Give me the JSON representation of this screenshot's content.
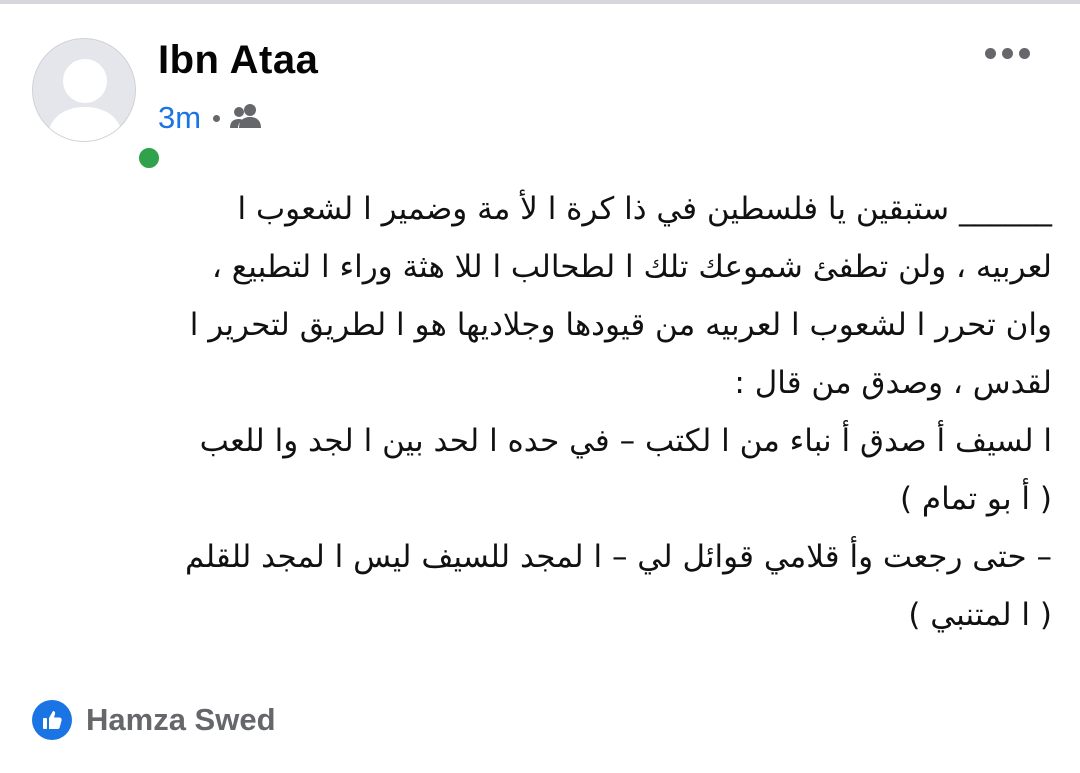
{
  "post": {
    "author": "Ibn Ataa",
    "time": "3m",
    "audience_icon": "friends-icon",
    "online_status_color": "#31a24c",
    "text_lines": [
      "______ ستبقين يا فلسطين في ذا كرة ا لأ مة وضمير ا لشعوب ا",
      "لعربيه ، ولن تطفئ شموعك تلك ا لطحالب  ا للا هثة وراء ا لتطبيع  ،",
      "وان تحرر ا لشعوب ا لعربيه من قيودها وجلاديها هو ا لطريق لتحرير  ا",
      "لقدس ، وصدق من قال :",
      "ا لسيف أ صدق أ نباء من ا لكتب – في حده ا لحد بين ا لجد وا للعب",
      "( أ بو تمام )",
      "– حتى رجعت وأ قلامي قوائل لي – ا لمجد للسيف ليس ا لمجد للقلم",
      "( ا لمتنبي )"
    ]
  },
  "reactions": {
    "icon": "like-icon",
    "name": "Hamza Swed"
  },
  "colors": {
    "link_blue": "#1b74e4",
    "secondary_text": "#65676b"
  }
}
